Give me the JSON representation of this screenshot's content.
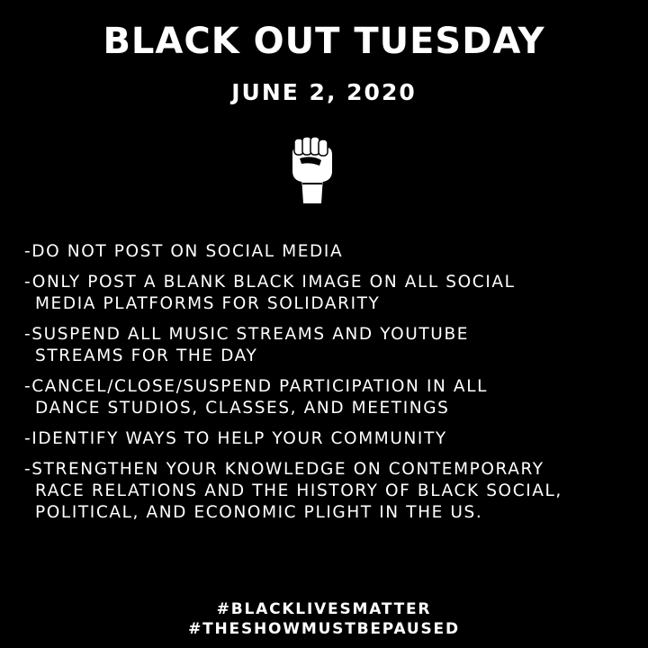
{
  "poster": {
    "title": "BLACK OUT TUESDAY",
    "date": "JUNE 2, 2020",
    "icon": "raised-fist-icon",
    "colors": {
      "background": "#000000",
      "text": "#ffffff"
    },
    "items": [
      {
        "line1": "-DO NOT POST ON SOCIAL MEDIA"
      },
      {
        "line1": "-ONLY POST A BLANK BLACK IMAGE ON ALL SOCIAL",
        "line2": "MEDIA PLATFORMS FOR SOLIDARITY"
      },
      {
        "line1": "-SUSPEND ALL MUSIC STREAMS AND YOUTUBE",
        "line2": "STREAMS FOR THE DAY"
      },
      {
        "line1": "-CANCEL/CLOSE/SUSPEND PARTICIPATION IN ALL",
        "line2": "DANCE STUDIOS, CLASSES, AND MEETINGS"
      },
      {
        "line1": "-IDENTIFY WAYS TO HELP YOUR COMMUNITY"
      },
      {
        "line1": "-STRENGTHEN YOUR KNOWLEDGE ON CONTEMPORARY",
        "line2": "RACE RELATIONS AND THE HISTORY OF BLACK SOCIAL,",
        "line3": "POLITICAL, AND ECONOMIC PLIGHT IN THE US."
      }
    ],
    "hashtags": [
      "#BLACKLIVESMATTER",
      "#THESHOWMUSTBEPAUSED"
    ]
  }
}
